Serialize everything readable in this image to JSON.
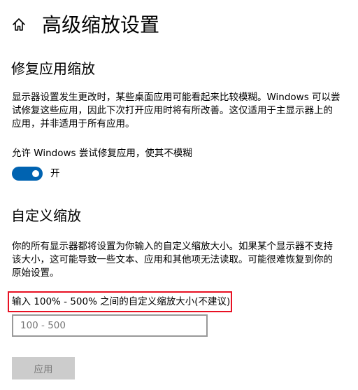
{
  "header": {
    "title": "高级缩放设置",
    "home_icon": "home-icon"
  },
  "fix_section": {
    "title": "修复应用缩放",
    "description": "显示器设置发生更改时，某些桌面应用可能看起来比较模糊。Windows 可以尝试修复这些应用，因此下次打开应用时将有所改善。这仅适用于主显示器上的应用，并非适用于所有应用。",
    "toggle_label": "允许 Windows 尝试修复应用，使其不模糊",
    "toggle_state": "开",
    "toggle_on": true,
    "toggle_color": "#0063b1"
  },
  "custom_section": {
    "title": "自定义缩放",
    "description": "你的所有显示器都将设置为你输入的自定义缩放大小。如果某个显示器不支持该大小，这可能导致一些文本、应用和其他项无法读取。可能很难恢复到你的原始设置。",
    "input_label": "输入 100% - 500% 之间的自定义缩放大小(不建议)",
    "input_value": "",
    "input_placeholder": "100 - 500",
    "apply_label": "应用",
    "highlight_color": "#e81123"
  }
}
